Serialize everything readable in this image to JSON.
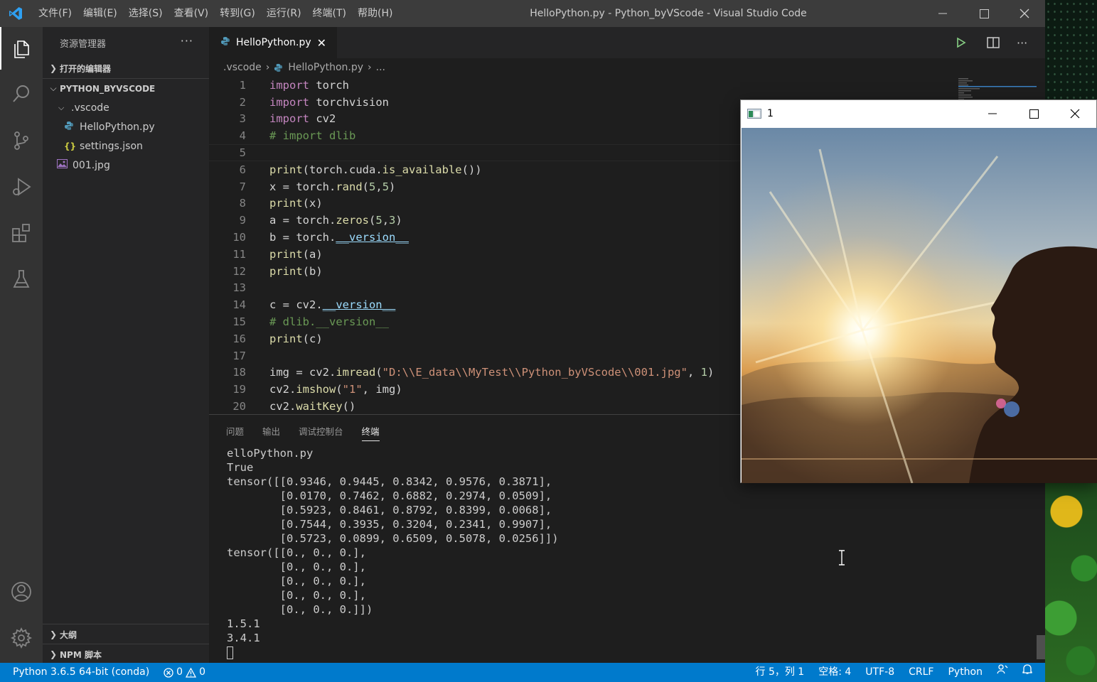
{
  "window": {
    "title": "HelloPython.py - Python_byVScode - Visual Studio Code",
    "menu": [
      "文件(F)",
      "编辑(E)",
      "选择(S)",
      "查看(V)",
      "转到(G)",
      "运行(R)",
      "终端(T)",
      "帮助(H)"
    ]
  },
  "sidebar": {
    "header": "资源管理器",
    "open_editors": "打开的编辑器",
    "workspace": "PYTHON_BYVSCODE",
    "tree": [
      {
        "label": ".vscode",
        "kind": "folder"
      },
      {
        "label": "HelloPython.py",
        "kind": "python"
      },
      {
        "label": "settings.json",
        "kind": "json"
      },
      {
        "label": "001.jpg",
        "kind": "image"
      }
    ],
    "outline": "大纲",
    "npm": "NPM 脚本"
  },
  "editor": {
    "tab_label": "HelloPython.py",
    "breadcrumb": [
      ".vscode",
      "HelloPython.py",
      "..."
    ],
    "current_line": 5,
    "lines": [
      "import torch",
      "import torchvision",
      "import cv2",
      "# import dlib",
      "",
      "print(torch.cuda.is_available())",
      "x = torch.rand(5,5)",
      "print(x)",
      "a = torch.zeros(5,3)",
      "b = torch.__version__",
      "print(a)",
      "print(b)",
      "",
      "c = cv2.__version__",
      "# dlib.__version__",
      "print(c)",
      "",
      "img = cv2.imread(\"D:\\\\E_data\\\\MyTest\\\\Python_byVScode\\\\001.jpg\", 1)",
      "cv2.imshow(\"1\", img)",
      "cv2.waitKey()"
    ]
  },
  "panel": {
    "tabs": [
      "问题",
      "输出",
      "调试控制台",
      "终端"
    ],
    "active_tab": "终端",
    "terminal_lines": [
      "elloPython.py",
      "True",
      "tensor([[0.9346, 0.9445, 0.8342, 0.9576, 0.3871],",
      "        [0.0170, 0.7462, 0.6882, 0.2974, 0.0509],",
      "        [0.5923, 0.8461, 0.8792, 0.8399, 0.0068],",
      "        [0.7544, 0.3935, 0.3204, 0.2341, 0.9907],",
      "        [0.5723, 0.0899, 0.6509, 0.5078, 0.0256]])",
      "tensor([[0., 0., 0.],",
      "        [0., 0., 0.],",
      "        [0., 0., 0.],",
      "        [0., 0., 0.],",
      "        [0., 0., 0.]])",
      "1.5.1",
      "3.4.1"
    ]
  },
  "statusbar": {
    "interpreter": "Python 3.6.5 64-bit (conda)",
    "errors": "0",
    "warnings": "0",
    "position": "行 5，列 1",
    "spaces": "空格: 4",
    "encoding": "UTF-8",
    "eol": "CRLF",
    "language": "Python"
  },
  "cv_window": {
    "title": "1"
  },
  "colors": {
    "statusbar": "#007acc",
    "titlebar": "#3c3c3c",
    "activitybar": "#333333",
    "sidebar": "#252526",
    "editor": "#1e1e1e",
    "keyword": "#c586c0",
    "function": "#dcdcaa",
    "comment": "#6a9955",
    "number": "#b5cea8",
    "string": "#ce9178"
  }
}
